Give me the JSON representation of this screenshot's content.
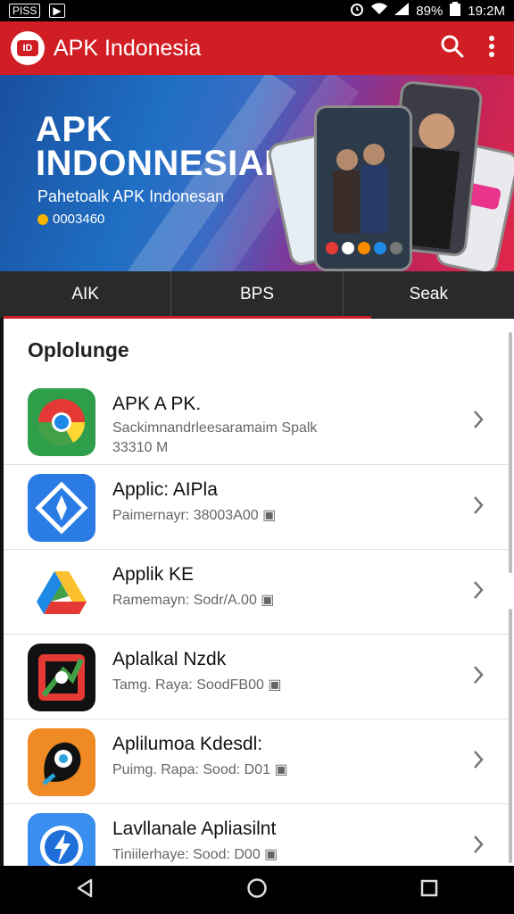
{
  "status": {
    "left_box": "PISS",
    "left_icon": "▶",
    "battery": "89%",
    "time": "19:2M"
  },
  "appbar": {
    "title": "APK Indonesia",
    "logo_text": "ID"
  },
  "banner": {
    "title_line1": "APK",
    "title_line2": "INDONNESIAI",
    "subtitle": "Pahetoalk APK Indonesan",
    "count": "0003460"
  },
  "tabs": [
    {
      "label": "AIK"
    },
    {
      "label": "BPS"
    },
    {
      "label": "Seak"
    }
  ],
  "section": {
    "title": "Oplolunge"
  },
  "apps": [
    {
      "title": "APK A PK.",
      "subtitle": "Sackimnandrleesaramaim Spalk",
      "size": "33310  M"
    },
    {
      "title": "Applic: AIPla",
      "subtitle": "Paimernayr: 38003A00 ▣"
    },
    {
      "title": "Applik KE",
      "subtitle": "Ramemayn: Sodr/A.00 ▣"
    },
    {
      "title": "Aplalkal Nzdk",
      "subtitle": "Tamg. Raya: SoodFB00 ▣"
    },
    {
      "title": "Aplilumoa Kdesdl:",
      "subtitle": "Puimg. Rapa: Sood: D01 ▣"
    },
    {
      "title": "Lavllanale Apliasilnt",
      "subtitle": "Tiniilerhaye: Sood: D00 ▣"
    }
  ],
  "colors": {
    "brand": "#d11e25",
    "tab_bg": "#2a2a2a"
  }
}
